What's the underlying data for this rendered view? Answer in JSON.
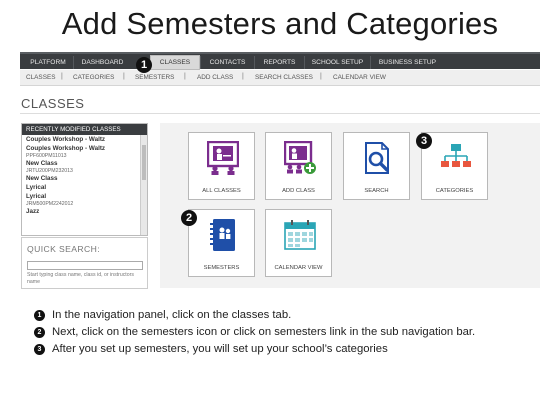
{
  "slide_title": "Add Semesters and Categories",
  "nav": {
    "tabs": [
      "PLATFORM",
      "DASHBOARD",
      "CLASSES",
      "CONTACTS",
      "REPORTS",
      "SCHOOL SETUP",
      "BUSINESS SETUP"
    ],
    "active_tab": "CLASSES"
  },
  "subnav": {
    "items": [
      "CLASSES",
      "CATEGORIES",
      "SEMESTERS",
      "ADD CLASS",
      "SEARCH CLASSES",
      "CALENDAR VIEW"
    ],
    "separator": "|"
  },
  "page_heading": "CLASSES",
  "recent": {
    "header": "RECENTLY MODIFIED CLASSES",
    "items": [
      {
        "name": "Couples Workshop - Waltz",
        "code": ""
      },
      {
        "name": "Couples Workshop - Waltz",
        "code": "PPF600PM11013"
      },
      {
        "name": "New Class",
        "code": "JRTU200PM232013"
      },
      {
        "name": "New Class",
        "code": ""
      },
      {
        "name": "Lyrical",
        "code": ""
      },
      {
        "name": "Lyrical",
        "code": "JRM500PM2242012"
      },
      {
        "name": "Jazz",
        "code": ""
      }
    ]
  },
  "quick_search": {
    "label": "QUICK SEARCH:",
    "value": "",
    "help": "Start typing class name, class id, or instructors name"
  },
  "tiles": [
    {
      "label": "ALL CLASSES",
      "icon": "all-classes-icon"
    },
    {
      "label": "ADD CLASS",
      "icon": "add-class-icon"
    },
    {
      "label": "SEARCH",
      "icon": "search-icon"
    },
    {
      "label": "CATEGORIES",
      "icon": "categories-icon"
    },
    {
      "label": "SEMESTERS",
      "icon": "semesters-icon"
    },
    {
      "label": "CALENDAR VIEW",
      "icon": "calendar-icon"
    }
  ],
  "callouts": [
    "1",
    "2",
    "3"
  ],
  "instructions": [
    {
      "num": "1",
      "text": "In the navigation panel, click on the classes tab."
    },
    {
      "num": "2",
      "text": "Next, click on the semesters icon or click on semesters  link in the sub navigation bar."
    },
    {
      "num": "3",
      "text": "After you set up semesters, you will set up your school’s categories"
    }
  ],
  "colors": {
    "navbar": "#3a3d40",
    "purple": "#7b2d8e",
    "green": "#3a9a3a",
    "teal": "#2aa5b5",
    "coral": "#e8573f",
    "blue": "#1f4fa8"
  }
}
